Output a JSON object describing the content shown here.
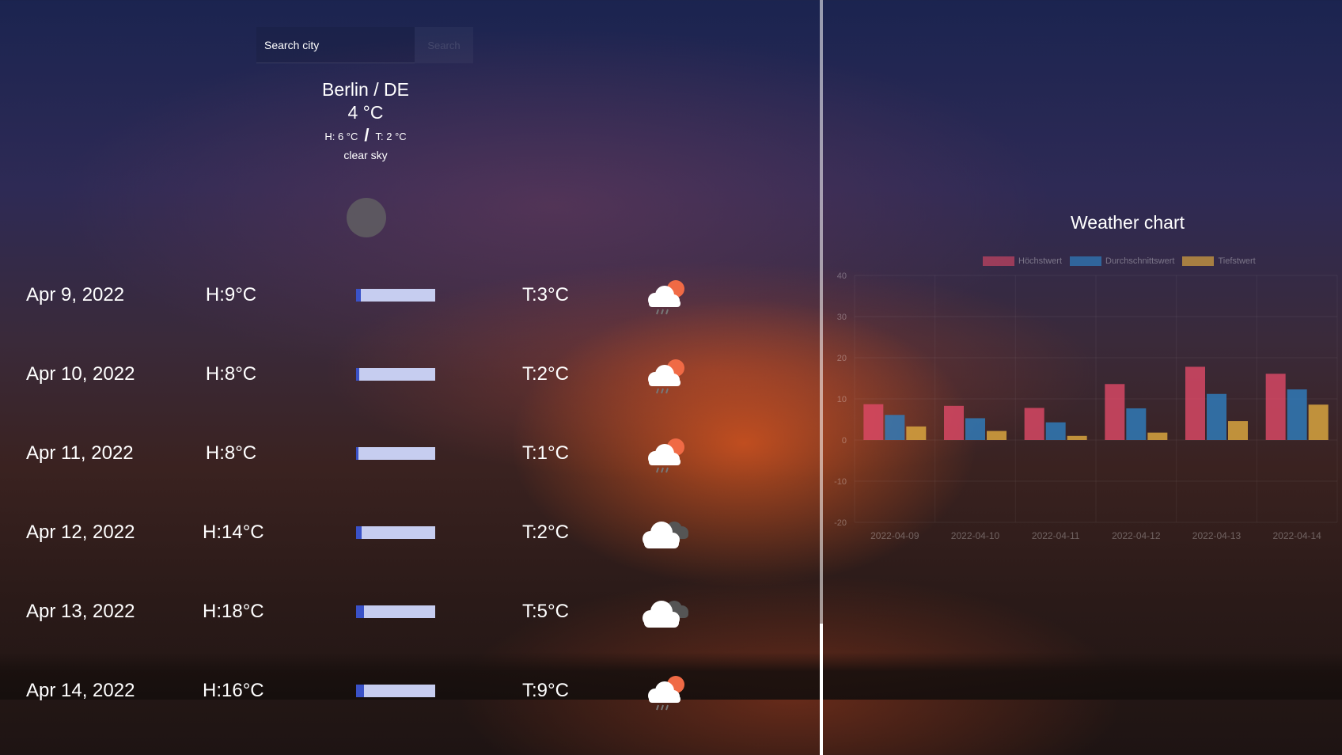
{
  "search": {
    "placeholder": "Search city",
    "button_label": "Search"
  },
  "current": {
    "city": "Berlin / DE",
    "temp": "4 °C",
    "high": "H: 6 °C",
    "separator": "/",
    "low": "T: 2 °C",
    "description": "clear sky"
  },
  "forecast": [
    {
      "date": "Apr 9, 2022",
      "high": "H:9°C",
      "low": "T:3°C",
      "bar_fraction": 0.06,
      "icon": "cloud-sun-rain-icon"
    },
    {
      "date": "Apr 10, 2022",
      "high": "H:8°C",
      "low": "T:2°C",
      "bar_fraction": 0.04,
      "icon": "cloud-sun-rain-icon"
    },
    {
      "date": "Apr 11, 2022",
      "high": "H:8°C",
      "low": "T:1°C",
      "bar_fraction": 0.03,
      "icon": "cloud-sun-rain-icon"
    },
    {
      "date": "Apr 12, 2022",
      "high": "H:14°C",
      "low": "T:2°C",
      "bar_fraction": 0.07,
      "icon": "cloudy-icon"
    },
    {
      "date": "Apr 13, 2022",
      "high": "H:18°C",
      "low": "T:5°C",
      "bar_fraction": 0.1,
      "icon": "cloudy-icon"
    },
    {
      "date": "Apr 14, 2022",
      "high": "H:16°C",
      "low": "T:9°C",
      "bar_fraction": 0.1,
      "icon": "cloud-sun-rain-icon"
    }
  ],
  "colors": {
    "bar_track": "#c6cdf0",
    "bar_fill": "#3a52c8",
    "high_series": "#e04a68",
    "avg_series": "#2f7fc0",
    "low_series": "#d8a440"
  },
  "chart_data": {
    "type": "bar",
    "title": "Weather chart",
    "categories": [
      "2022-04-09",
      "2022-04-10",
      "2022-04-11",
      "2022-04-12",
      "2022-04-13",
      "2022-04-14"
    ],
    "series": [
      {
        "name": "Höchstwert",
        "values": [
          8.7,
          8.3,
          7.8,
          13.6,
          17.8,
          16.1
        ]
      },
      {
        "name": "Durchschnittswert",
        "values": [
          6.1,
          5.3,
          4.3,
          7.7,
          11.2,
          12.3
        ]
      },
      {
        "name": "Tiefstwert",
        "values": [
          3.3,
          2.2,
          1.0,
          1.8,
          4.6,
          8.6
        ]
      }
    ],
    "ylim": [
      -20,
      40
    ],
    "yticks": [
      "40",
      "30",
      "20",
      "10",
      "0",
      "-10",
      "-20"
    ],
    "legend_position": "top",
    "grid": true
  }
}
